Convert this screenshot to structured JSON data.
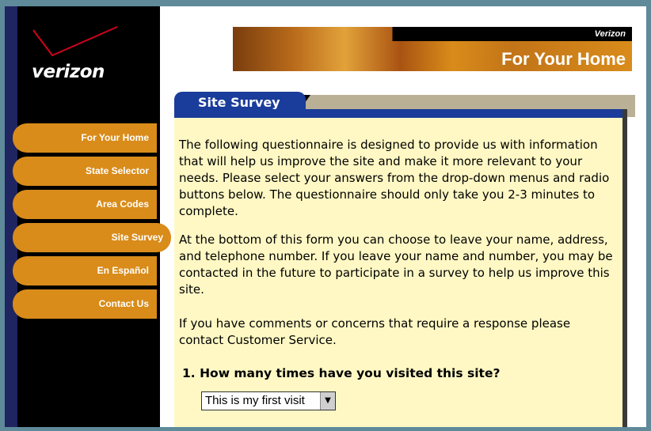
{
  "brand": {
    "logo_text": "verizon"
  },
  "header": {
    "small": "Verizon",
    "title": "For Your Home"
  },
  "tab": {
    "label": "Site Survey"
  },
  "nav": {
    "items": [
      {
        "label": "For Your Home"
      },
      {
        "label": "State Selector"
      },
      {
        "label": "Area Codes"
      },
      {
        "label": "Site Survey",
        "active": true
      },
      {
        "label": "En Español"
      },
      {
        "label": "Contact Us"
      }
    ]
  },
  "content": {
    "para1": "The following questionnaire is designed to provide us with information that will help us improve the site and make it more relevant to your needs. Please select your answers from the drop-down menus and radio buttons below. The questionnaire should only take you 2-3 minutes to complete.",
    "para2": "At the bottom of this form you can choose to leave your name, address, and telephone number. If you leave your name and number, you may be contacted in the future to participate in a survey to help us improve this site.",
    "para3": "If you have comments or concerns that require a response please contact Customer Service.",
    "question1": "1. How many times have you visited this site?",
    "question1_selected": "This is my first visit"
  },
  "colors": {
    "nav_orange": "#d98c1a",
    "brand_blue": "#1a3c9a",
    "content_bg": "#fff8c4",
    "logo_red": "#d0021b"
  }
}
